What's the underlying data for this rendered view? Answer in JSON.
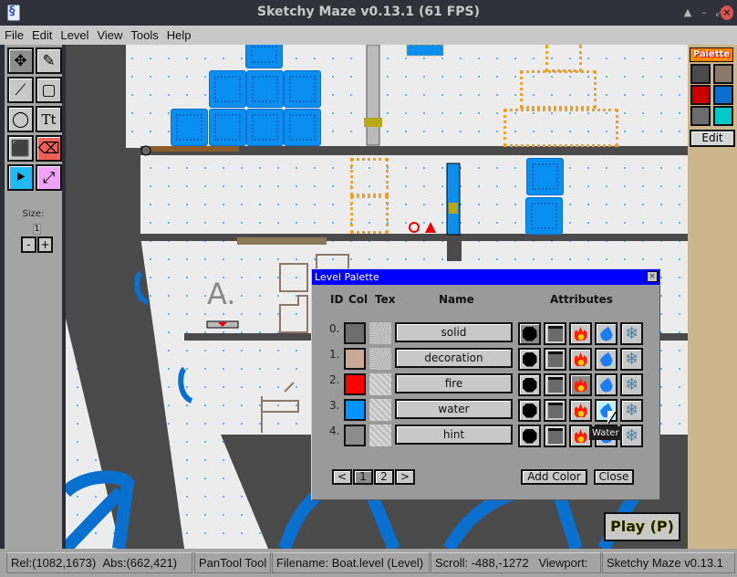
{
  "window": {
    "title": "Sketchy Maze v0.13.1 (61 FPS)",
    "controls": [
      "eject",
      "minimize",
      "maximize",
      "close"
    ]
  },
  "menubar": {
    "items": [
      {
        "label": "File"
      },
      {
        "label": "Edit"
      },
      {
        "label": "Level"
      },
      {
        "label": "View"
      },
      {
        "label": "Tools"
      },
      {
        "label": "Help"
      }
    ]
  },
  "toolbox": {
    "tools": [
      {
        "name": "pan-tool",
        "icon": "✥",
        "active": true
      },
      {
        "name": "pencil-tool",
        "icon": "✎"
      },
      {
        "name": "line-tool",
        "icon": "⟋"
      },
      {
        "name": "rectangle-tool",
        "icon": "▢"
      },
      {
        "name": "ellipse-tool",
        "icon": "◯"
      },
      {
        "name": "text-tool",
        "icon": "Tt"
      },
      {
        "name": "fill-tool",
        "icon": "⬛"
      },
      {
        "name": "eraser-tool",
        "icon": "⌫"
      },
      {
        "name": "actor-tool",
        "icon": "⯈"
      },
      {
        "name": "link-tool",
        "icon": "⤢"
      }
    ],
    "size_label": "Size:",
    "size_value": "1",
    "size_minus": "-",
    "size_plus": "+"
  },
  "palette_panel": {
    "title": "Palette",
    "swatches": [
      {
        "name": "solid",
        "color": "#4a4a4a"
      },
      {
        "name": "decoration",
        "color": "#8a7868"
      },
      {
        "name": "fire",
        "color": "#cc0000"
      },
      {
        "name": "water",
        "color": "#0a6fd0"
      },
      {
        "name": "hint",
        "color": "#6c6c6c"
      },
      {
        "name": "cyan",
        "color": "#00c8c8"
      }
    ],
    "edit_label": "Edit"
  },
  "level_palette_dialog": {
    "title": "Level Palette",
    "close_icon": "×",
    "headers": {
      "id": "ID",
      "col": "Col",
      "tex": "Tex",
      "name": "Name",
      "attributes": "Attributes"
    },
    "rows": [
      {
        "id": "0.",
        "color": "#6e6e6e",
        "name": "solid",
        "attrs": {
          "solid": true,
          "decoration": false,
          "fire": false,
          "water": false,
          "frozen": false
        }
      },
      {
        "id": "1.",
        "color": "#caa896",
        "name": "decoration",
        "attrs": {
          "solid": false,
          "decoration": false,
          "fire": false,
          "water": false,
          "frozen": false
        }
      },
      {
        "id": "2.",
        "color": "#ff0000",
        "name": "fire",
        "attrs": {
          "solid": false,
          "decoration": false,
          "fire": true,
          "water": false,
          "frozen": false
        }
      },
      {
        "id": "3.",
        "color": "#0094ff",
        "name": "water",
        "attrs": {
          "solid": false,
          "decoration": false,
          "fire": false,
          "water": true,
          "frozen": false
        }
      },
      {
        "id": "4.",
        "color": "#8c8c8c",
        "name": "hint",
        "attrs": {
          "solid": false,
          "decoration": false,
          "fire": false,
          "water": false,
          "frozen": false
        }
      }
    ],
    "tooltip": "Water",
    "pager": {
      "prev": "<",
      "pages": [
        "1",
        "2"
      ],
      "current": "1",
      "next": ">"
    },
    "add_color_label": "Add Color",
    "close_label": "Close"
  },
  "canvas": {
    "text_label": "A."
  },
  "play_button": {
    "label": "Play (P)"
  },
  "statusbar": {
    "rel": "Rel:(1082,1673)",
    "abs": "Abs:(662,421)",
    "tool": "PanTool Tool",
    "filename": "Filename: Boat.level (Level)",
    "scroll": "Scroll: -488,-1272",
    "viewport_label": "Viewport:",
    "viewport_value": "Sketchy Maze v0.13.1"
  }
}
